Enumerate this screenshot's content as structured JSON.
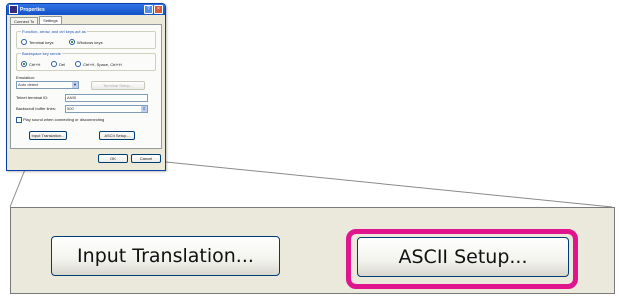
{
  "window": {
    "title": "Properties",
    "tabs": [
      "Connect To",
      "Settings"
    ],
    "active_tab": "Settings"
  },
  "settings": {
    "keys_group": {
      "label": "Function, arrow, and ctrl keys act as",
      "options": [
        "Terminal keys",
        "Windows keys"
      ],
      "selected": "Windows keys"
    },
    "backspace_group": {
      "label": "Backspace key sends",
      "options": [
        "Ctrl+H",
        "Del",
        "Ctrl+H, Space, Ctrl+H"
      ],
      "selected": "Ctrl+H"
    },
    "emulation": {
      "label": "Emulation:",
      "value": "Auto detect",
      "setup_button": "Terminal Setup..."
    },
    "telnet_id": {
      "label": "Telnet terminal ID:",
      "value": "ANSI"
    },
    "buffer_lines": {
      "label": "Backscroll buffer lines:",
      "value": "500"
    },
    "play_sound": {
      "label": "Play sound when connecting or disconnecting",
      "checked": false
    },
    "buttons": {
      "input_translation": "Input Translation...",
      "ascii_setup": "ASCII Setup..."
    },
    "dialog_buttons": {
      "ok": "OK",
      "cancel": "Cancel"
    }
  },
  "zoom": {
    "input_translation": "Input Translation...",
    "ascii_setup": "ASCII Setup...",
    "highlight_color": "#e0148c"
  }
}
